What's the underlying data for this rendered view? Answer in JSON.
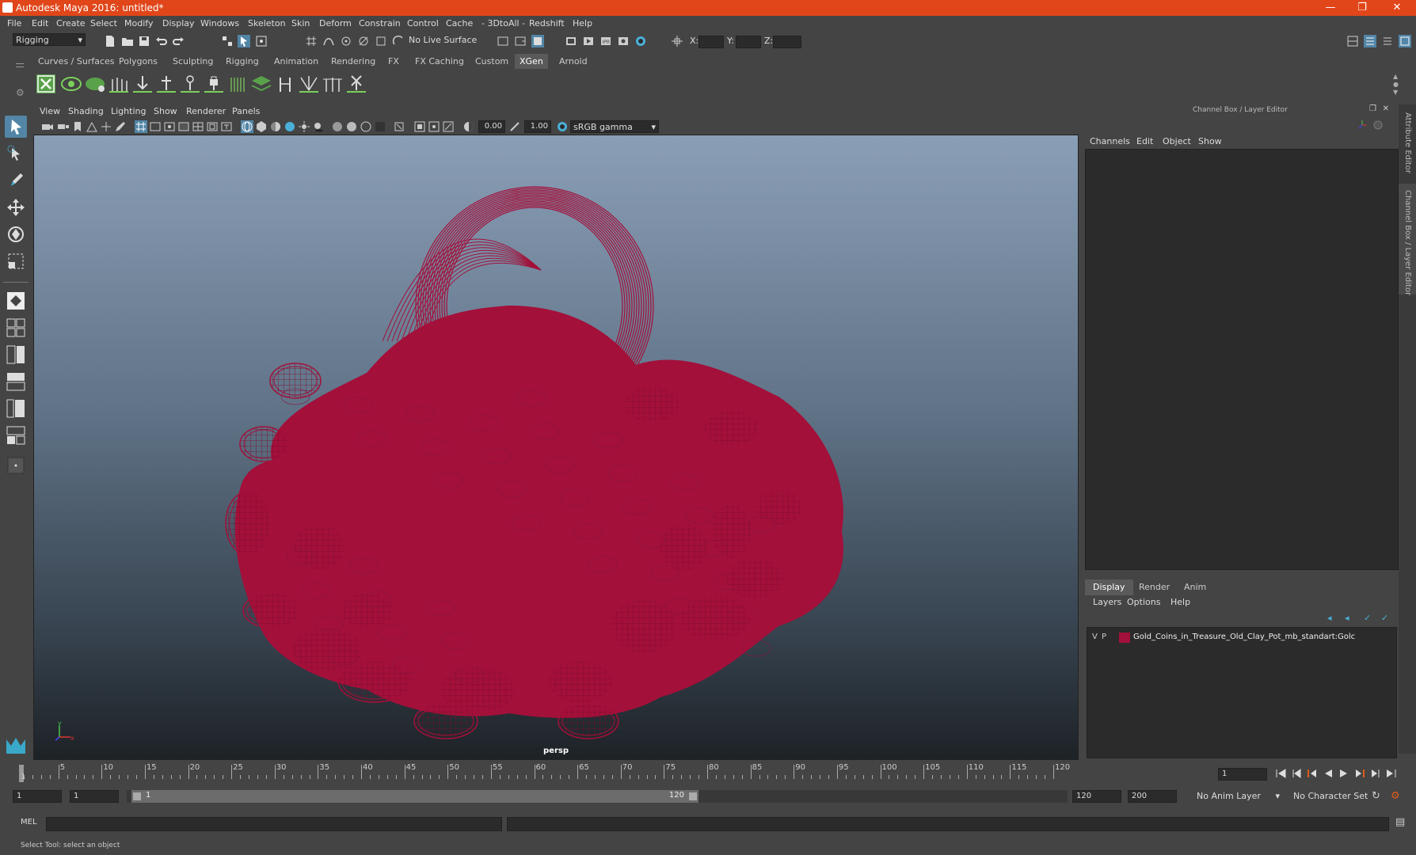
{
  "window": {
    "title": "Autodesk Maya 2016: untitled*"
  },
  "menubar": [
    "File",
    "Edit",
    "Create",
    "Select",
    "Modify",
    "Display",
    "Windows",
    "Skeleton",
    "Skin",
    "Deform",
    "Constrain",
    "Control",
    "Cache",
    "- 3DtoAll -",
    "Redshift",
    "Help"
  ],
  "statusline": {
    "menuset": "Rigging",
    "live_surface": "No Live Surface",
    "x_label": "X:",
    "y_label": "Y:",
    "z_label": "Z:"
  },
  "shelf": {
    "tabs": [
      "Curves / Surfaces",
      "Polygons",
      "Sculpting",
      "Rigging",
      "Animation",
      "Rendering",
      "FX",
      "FX Caching",
      "Custom",
      "XGen",
      "Arnold"
    ],
    "active_tab": "XGen"
  },
  "viewport": {
    "menu": [
      "View",
      "Shading",
      "Lighting",
      "Show",
      "Renderer",
      "Panels"
    ],
    "exposure": "0.00",
    "gamma": "1.00",
    "color_space": "sRGB gamma",
    "camera_label": "persp",
    "wire_color": "#a3103a"
  },
  "channelbox": {
    "title": "Channel Box / Layer Editor",
    "menu": [
      "Channels",
      "Edit",
      "Object",
      "Show"
    ]
  },
  "layer_editor": {
    "tabs": [
      "Display",
      "Render",
      "Anim"
    ],
    "active_tab": "Display",
    "menu": [
      "Layers",
      "Options",
      "Help"
    ],
    "layers": [
      {
        "visible": "V",
        "playback": "P",
        "color": "#a3103a",
        "name": "Gold_Coins_in_Treasure_Old_Clay_Pot_mb_standart:Golc"
      }
    ]
  },
  "side_tabs": [
    "Attribute Editor",
    "Channel Box / Layer Editor"
  ],
  "timeslider": {
    "ticks": [
      5,
      10,
      15,
      20,
      25,
      30,
      35,
      40,
      45,
      50,
      55,
      60,
      65,
      70,
      75,
      80,
      85,
      90,
      95,
      100,
      105,
      110,
      115,
      120
    ],
    "current_frame": "1",
    "first_label": "1"
  },
  "range": {
    "start_time": "1",
    "playback_start": "1",
    "slider_start": "1",
    "slider_end": "120",
    "playback_end": "120",
    "end_time": "200",
    "anim_layer": "No Anim Layer",
    "character_set": "No Character Set"
  },
  "command_line": {
    "label": "MEL"
  },
  "help_line": "Select Tool: select an object"
}
